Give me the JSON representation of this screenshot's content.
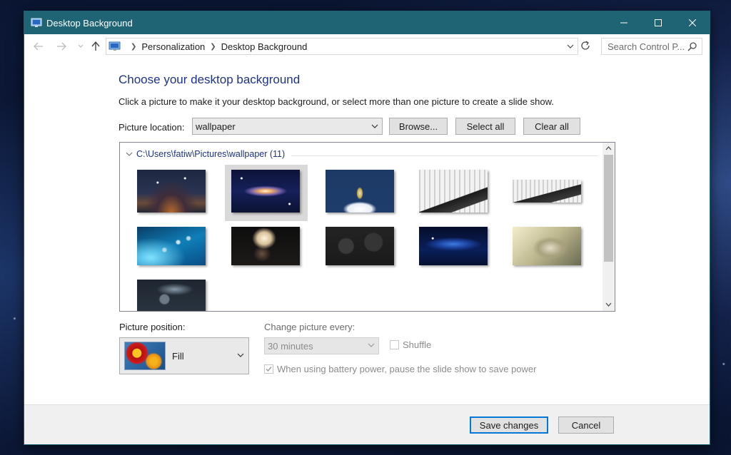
{
  "window": {
    "title": "Desktop Background",
    "controls": {
      "minimize": "minimize",
      "maximize": "maximize",
      "close": "close"
    }
  },
  "address_bar": {
    "breadcrumbs": [
      "Personalization",
      "Desktop Background"
    ],
    "search_placeholder": "Search Control P..."
  },
  "main": {
    "heading": "Choose your desktop background",
    "description": "Click a picture to make it your desktop background, or select more than one picture to create a slide show.",
    "picture_location_label": "Picture location:",
    "picture_location_value": "wallpaper",
    "browse_label": "Browse...",
    "select_all_label": "Select all",
    "clear_all_label": "Clear all"
  },
  "gallery": {
    "group_path": "C:\\Users\\fatiw\\Pictures\\wallpaper (11)",
    "selected_index": 1,
    "thumbnails": [
      {
        "name": "starry-night-lake"
      },
      {
        "name": "galaxy"
      },
      {
        "name": "rocket-launch"
      },
      {
        "name": "snowy-road"
      },
      {
        "name": "snowy-road-panorama"
      },
      {
        "name": "blue-bokeh"
      },
      {
        "name": "smoke-explosion"
      },
      {
        "name": "dark-paisley"
      },
      {
        "name": "blue-nebula"
      },
      {
        "name": "sleeping-cat"
      },
      {
        "name": "dark-abstract"
      }
    ]
  },
  "options": {
    "picture_position_label": "Picture position:",
    "picture_position_value": "Fill",
    "change_picture_label": "Change picture every:",
    "change_picture_value": "30 minutes",
    "shuffle_label": "Shuffle",
    "battery_label": "When using battery power, pause the slide show to save power",
    "battery_checked": true,
    "shuffle_checked": false
  },
  "footer": {
    "save_label": "Save changes",
    "cancel_label": "Cancel"
  },
  "colors": {
    "titlebar": "#1f6475",
    "heading": "#1e3287",
    "primary_button_border": "#0078d7"
  }
}
